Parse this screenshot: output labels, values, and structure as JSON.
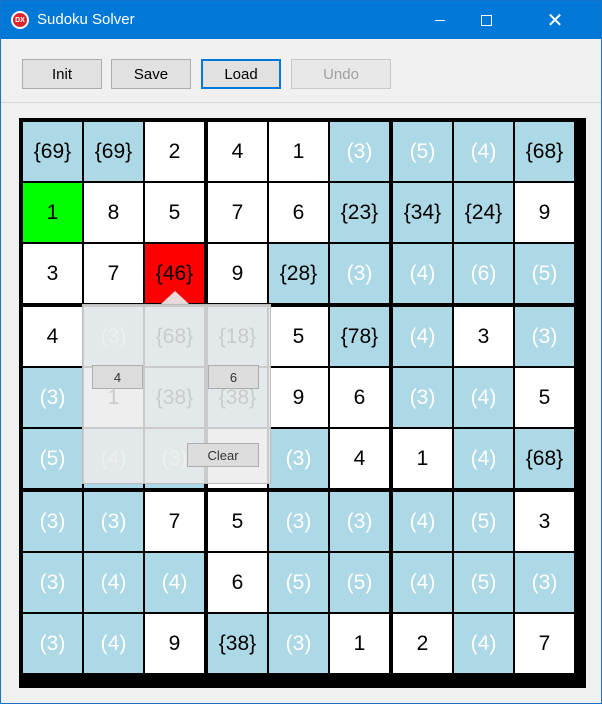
{
  "window": {
    "title": "Sudoku Solver",
    "icon_text": "DX",
    "min_icon": "minimize-icon",
    "max_icon": "maximize-icon",
    "close_icon": "close-icon",
    "close_glyph": "✕"
  },
  "toolbar": {
    "init_label": "Init",
    "save_label": "Save",
    "load_label": "Load",
    "undo_label": "Undo"
  },
  "colors": {
    "titlebar": "#0078d7",
    "candidate_cell": "#add8e6",
    "given_cell": "#ffffff",
    "highlight_green": "#00ff00",
    "conflict_red": "#ff0000"
  },
  "board": {
    "rows": [
      [
        {
          "t": "{69}",
          "s": "blue-pot"
        },
        {
          "t": "{69}",
          "s": "blue-pot"
        },
        {
          "t": "2",
          "s": "white"
        },
        {
          "t": "4",
          "s": "white"
        },
        {
          "t": "1",
          "s": "white"
        },
        {
          "t": "(3)",
          "s": "blue"
        },
        {
          "t": "(5)",
          "s": "blue"
        },
        {
          "t": "(4)",
          "s": "blue"
        },
        {
          "t": "{68}",
          "s": "blue-pot"
        }
      ],
      [
        {
          "t": "1",
          "s": "green"
        },
        {
          "t": "8",
          "s": "white"
        },
        {
          "t": "5",
          "s": "white"
        },
        {
          "t": "7",
          "s": "white"
        },
        {
          "t": "6",
          "s": "white"
        },
        {
          "t": "{23}",
          "s": "blue-pot"
        },
        {
          "t": "{34}",
          "s": "blue-pot"
        },
        {
          "t": "{24}",
          "s": "blue-pot"
        },
        {
          "t": "9",
          "s": "white"
        }
      ],
      [
        {
          "t": "3",
          "s": "white"
        },
        {
          "t": "7",
          "s": "white"
        },
        {
          "t": "{46}",
          "s": "red"
        },
        {
          "t": "9",
          "s": "white"
        },
        {
          "t": "{28}",
          "s": "blue-pot"
        },
        {
          "t": "(3)",
          "s": "blue"
        },
        {
          "t": "(4)",
          "s": "blue"
        },
        {
          "t": "(6)",
          "s": "blue"
        },
        {
          "t": "(5)",
          "s": "blue"
        }
      ],
      [
        {
          "t": "4",
          "s": "white"
        },
        {
          "t": "(3)",
          "s": "blue"
        },
        {
          "t": "{68}",
          "s": "blue-pot"
        },
        {
          "t": "{18}",
          "s": "blue-pot"
        },
        {
          "t": "5",
          "s": "white"
        },
        {
          "t": "{78}",
          "s": "blue-pot"
        },
        {
          "t": "(4)",
          "s": "blue"
        },
        {
          "t": "3",
          "s": "white"
        },
        {
          "t": "(3)",
          "s": "blue"
        }
      ],
      [
        {
          "t": "(3)",
          "s": "blue"
        },
        {
          "t": "1",
          "s": "white"
        },
        {
          "t": "{38}",
          "s": "blue-pot"
        },
        {
          "t": "{38}",
          "s": "blue-pot"
        },
        {
          "t": "9",
          "s": "white"
        },
        {
          "t": "6",
          "s": "white"
        },
        {
          "t": "(3)",
          "s": "blue"
        },
        {
          "t": "(4)",
          "s": "blue"
        },
        {
          "t": "5",
          "s": "white"
        }
      ],
      [
        {
          "t": "(5)",
          "s": "blue"
        },
        {
          "t": "(4)",
          "s": "blue"
        },
        {
          "t": "(3)",
          "s": "blue"
        },
        {
          "t": "2",
          "s": "white"
        },
        {
          "t": "(3)",
          "s": "blue"
        },
        {
          "t": "4",
          "s": "white"
        },
        {
          "t": "1",
          "s": "white"
        },
        {
          "t": "(4)",
          "s": "blue"
        },
        {
          "t": "{68}",
          "s": "blue-pot"
        }
      ],
      [
        {
          "t": "(3)",
          "s": "blue"
        },
        {
          "t": "(3)",
          "s": "blue"
        },
        {
          "t": "7",
          "s": "white"
        },
        {
          "t": "5",
          "s": "white"
        },
        {
          "t": "(3)",
          "s": "blue"
        },
        {
          "t": "(3)",
          "s": "blue"
        },
        {
          "t": "(4)",
          "s": "blue"
        },
        {
          "t": "(5)",
          "s": "blue"
        },
        {
          "t": "3",
          "s": "white"
        }
      ],
      [
        {
          "t": "(3)",
          "s": "blue"
        },
        {
          "t": "(4)",
          "s": "blue"
        },
        {
          "t": "(4)",
          "s": "blue"
        },
        {
          "t": "6",
          "s": "white"
        },
        {
          "t": "(5)",
          "s": "blue"
        },
        {
          "t": "(5)",
          "s": "blue"
        },
        {
          "t": "(4)",
          "s": "blue"
        },
        {
          "t": "(5)",
          "s": "blue"
        },
        {
          "t": "(3)",
          "s": "blue"
        }
      ],
      [
        {
          "t": "(3)",
          "s": "blue"
        },
        {
          "t": "(4)",
          "s": "blue"
        },
        {
          "t": "9",
          "s": "white"
        },
        {
          "t": "{38}",
          "s": "blue-pot"
        },
        {
          "t": "(3)",
          "s": "blue"
        },
        {
          "t": "1",
          "s": "white"
        },
        {
          "t": "2",
          "s": "white"
        },
        {
          "t": "(4)",
          "s": "blue"
        },
        {
          "t": "7",
          "s": "white"
        }
      ]
    ]
  },
  "popup": {
    "option_a": "4",
    "option_b": "6",
    "clear_label": "Clear"
  }
}
